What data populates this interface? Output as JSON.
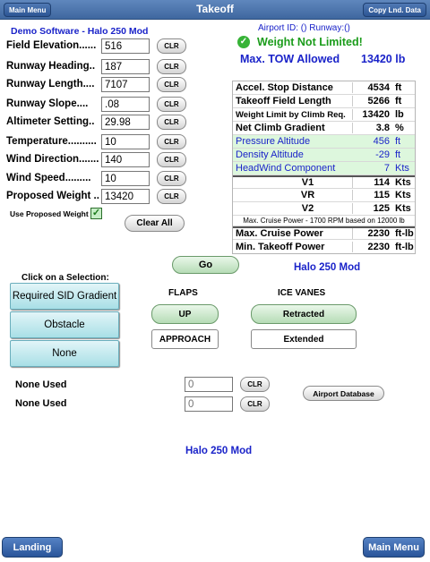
{
  "topbar": {
    "title": "Takeoff",
    "main_menu_label": "Main Menu",
    "copy_data_label": "Copy Lnd. Data"
  },
  "demo_title": "Demo Software - Halo 250 Mod",
  "airport_info": "Airport ID: () Runway:()",
  "weight_status": "Weight Not Limited!",
  "max_tow": {
    "label": "Max. TOW Allowed",
    "value": "13420 lb"
  },
  "inputs": [
    {
      "label": "Field Elevation......",
      "value": "516"
    },
    {
      "label": "Runway Heading..",
      "value": "187"
    },
    {
      "label": "Runway Length....",
      "value": "7107"
    },
    {
      "label": "Runway Slope....",
      "value": ".08"
    },
    {
      "label": "Altimeter Setting..",
      "value": "29.98"
    },
    {
      "label": "Temperature..........",
      "value": "10"
    },
    {
      "label": "Wind Direction.......",
      "value": "140"
    },
    {
      "label": "Wind Speed.........",
      "value": "10"
    },
    {
      "label": "Proposed Weight ..",
      "value": "13420"
    }
  ],
  "clr_label": "CLR",
  "use_proposed_label": "Use Proposed Weight",
  "use_proposed_checked": "✓",
  "clear_all_label": "Clear All",
  "results": {
    "accel_stop": {
      "name": "Accel. Stop Distance",
      "value": "4534",
      "unit": "ft"
    },
    "takeoff_field": {
      "name": "Takeoff Field Length",
      "value": "5266",
      "unit": "ft"
    },
    "climb_limit": {
      "name": "Weight Limit by Climb Req.",
      "value": "13420",
      "unit": "lb"
    },
    "net_climb": {
      "name": "Net Climb Gradient",
      "value": "3.8",
      "unit": "%"
    },
    "pressure_alt": {
      "name": "Pressure Altitude",
      "value": "456",
      "unit": "ft"
    },
    "density_alt": {
      "name": "Density Altitude",
      "value": "-29",
      "unit": "ft"
    },
    "headwind": {
      "name": "HeadWind Component",
      "value": "7",
      "unit": "Kts"
    },
    "v1": {
      "name": "V1",
      "value": "114",
      "unit": "Kts"
    },
    "vr": {
      "name": "VR",
      "value": "115",
      "unit": "Kts"
    },
    "v2": {
      "name": "V2",
      "value": "125",
      "unit": "Kts"
    },
    "cruise_note": "Max. Cruise Power - 1700 RPM based on 12000 lb",
    "max_cruise": {
      "name": "Max. Cruise Power",
      "value": "2230",
      "unit": "ft-lb"
    },
    "min_takeoff": {
      "name": "Min. Takeoff Power",
      "value": "2230",
      "unit": "ft-lb"
    }
  },
  "go_label": "Go",
  "model_label": "Halo 250 Mod",
  "selection": {
    "heading": "Click on a Selection:",
    "options": [
      "Required SID Gradient",
      "Obstacle",
      "None"
    ]
  },
  "flaps": {
    "heading": "FLAPS",
    "up_label": "UP",
    "approach_label": "APPROACH"
  },
  "ice_vanes": {
    "heading": "ICE VANES",
    "retracted_label": "Retracted",
    "extended_label": "Extended"
  },
  "none_used": [
    {
      "label": "None Used",
      "placeholder": "0"
    },
    {
      "label": "None Used",
      "placeholder": "0"
    }
  ],
  "airport_db_label": "Airport Database",
  "bottom_model_label": "Halo 250 Mod",
  "bottom": {
    "landing_label": "Landing",
    "main_menu_label": "Main Menu"
  },
  "colors": {
    "accent_blue": "#1a23c9",
    "status_green": "#1b9c1b",
    "highlight_row": "#ddf7dd"
  }
}
